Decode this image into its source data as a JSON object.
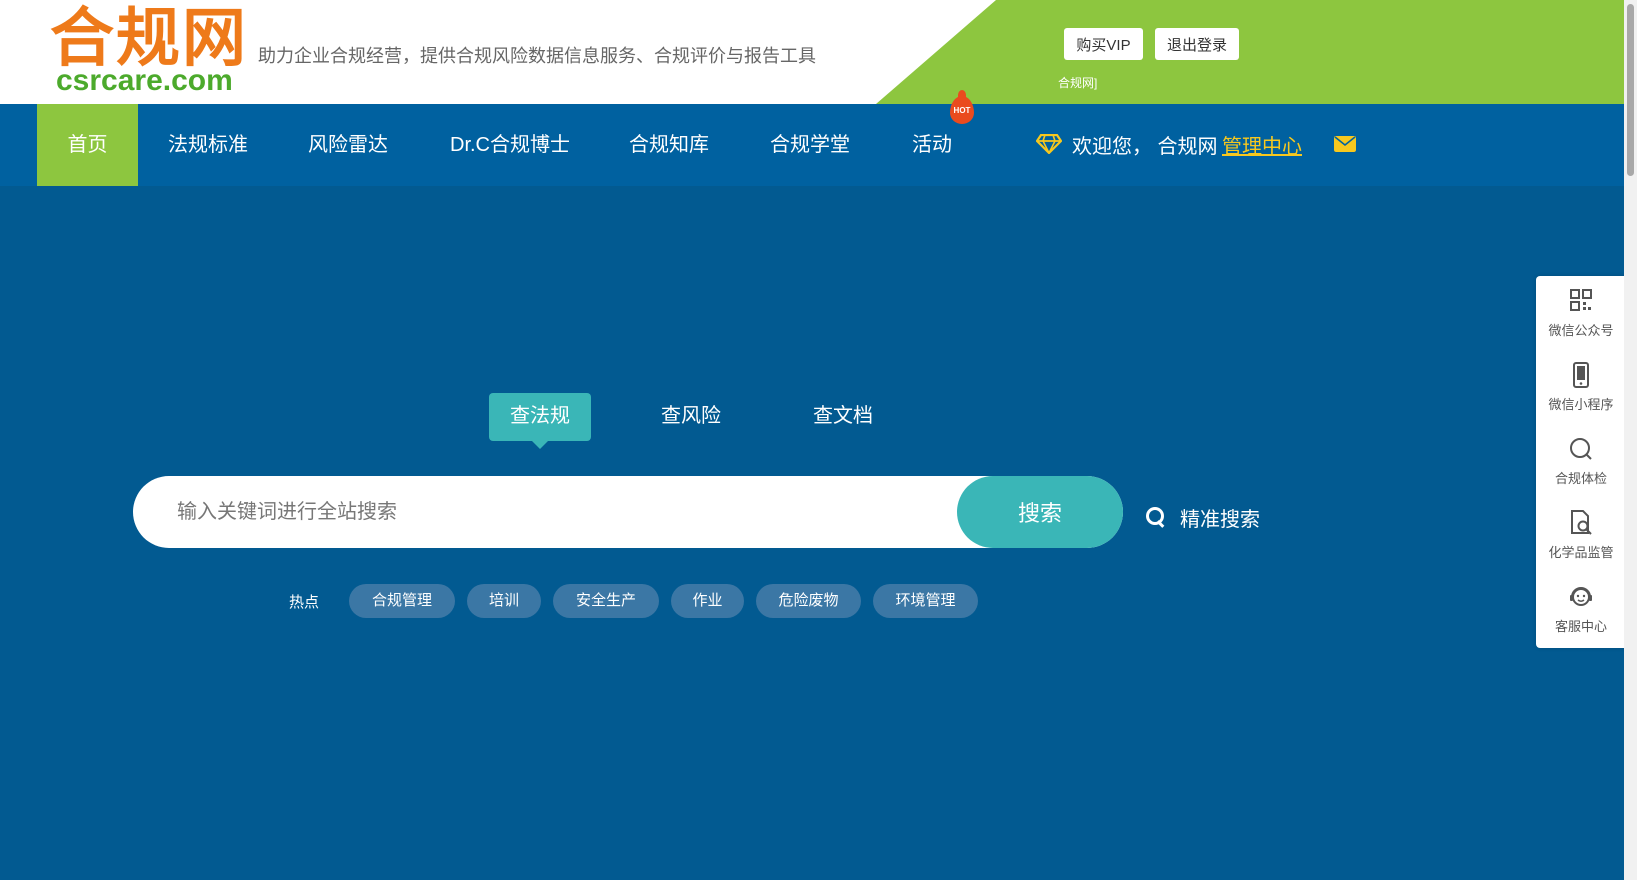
{
  "header": {
    "logo_cn": "合规网",
    "logo_en": "csrcare.com",
    "tagline": "助力企业合规经营，提供合规风险数据信息服务、合规评价与报告工具",
    "buy_vip": "购买VIP",
    "logout": "退出登录",
    "user_line": "合规网]",
    "colors": {
      "green": "#8dc63f",
      "orange": "#ee7a1a",
      "logo_green": "#4caa2c"
    }
  },
  "nav": {
    "items": [
      {
        "label": "首页",
        "active": true
      },
      {
        "label": "法规标准"
      },
      {
        "label": "风险雷达"
      },
      {
        "label": "Dr.C合规博士"
      },
      {
        "label": "合规知库"
      },
      {
        "label": "合规学堂"
      },
      {
        "label": "活动"
      }
    ],
    "hot_badge": "HOT",
    "welcome": "欢迎您，  合规网",
    "management_center": "管理中心",
    "icons": {
      "vip": "diamond-icon",
      "mail": "mail-icon"
    },
    "colors": {
      "bar": "#0061a0",
      "active": "#8dc63f",
      "link": "#f7c81e"
    }
  },
  "search": {
    "tabs": [
      {
        "label": "查法规",
        "active": true
      },
      {
        "label": "查风险"
      },
      {
        "label": "查文档"
      }
    ],
    "placeholder": "输入关键词进行全站搜索",
    "value": "",
    "button": "搜索",
    "advanced": "精准搜索",
    "hot_label": "热点",
    "hot_tags": [
      "合规管理",
      "培训",
      "安全生产",
      "作业",
      "危险废物",
      "环境管理"
    ],
    "colors": {
      "accent": "#3ab6b7",
      "tag": "#3b77a5",
      "background": "#025a91"
    }
  },
  "float_bar": {
    "items": [
      {
        "label": "微信公众号",
        "icon": "qr-code-icon"
      },
      {
        "label": "微信小程序",
        "icon": "mobile-phone-icon"
      },
      {
        "label": "合规体检",
        "icon": "search-circle-icon"
      },
      {
        "label": "化学品监管",
        "icon": "document-search-icon"
      },
      {
        "label": "客服中心",
        "icon": "customer-service-icon"
      }
    ]
  }
}
